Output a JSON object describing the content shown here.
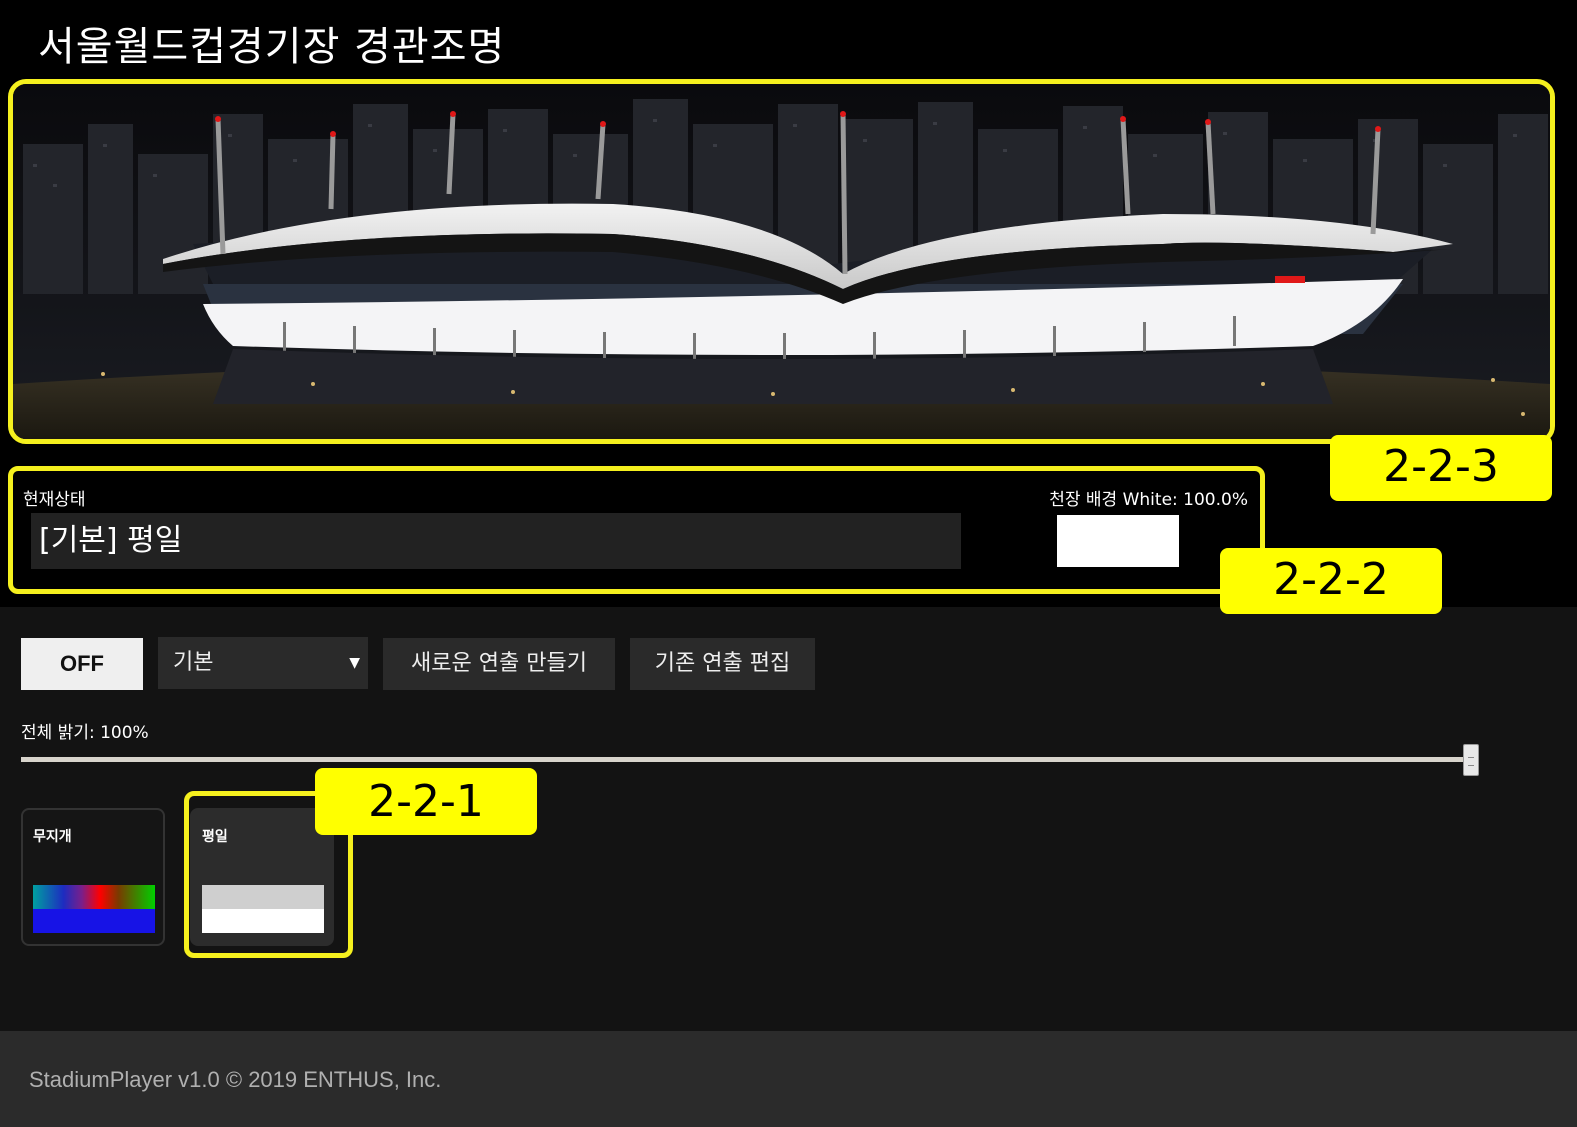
{
  "header": {
    "title": "서울월드컵경기장 경관조명"
  },
  "preview": {
    "callout": "2-2-3"
  },
  "status": {
    "label": "현재상태",
    "value": "[기본] 평일",
    "background_label": "천장 배경 White: 100.0%",
    "background_color": "#ffffff",
    "callout": "2-2-2"
  },
  "controls": {
    "off_label": "OFF",
    "program_selected": "기본",
    "new_show_label": "새로운 연출 만들기",
    "edit_show_label": "기존 연출 편집",
    "brightness_label": "전체 밝기: 100%",
    "brightness_value": 1.0
  },
  "presets": {
    "items": [
      {
        "name": "무지개",
        "colors": [
          "#1713e6",
          "#00d000",
          "#ff0000"
        ]
      },
      {
        "name": "평일",
        "colors": [
          "#cfcfcf",
          "#ffffff"
        ]
      }
    ],
    "callout": "2-2-1"
  },
  "footer": {
    "text": "StadiumPlayer v1.0 © 2019 ENTHUS, Inc."
  },
  "theme": {
    "accent": "#ffff00",
    "background": "#131313",
    "panel": "#000000"
  }
}
